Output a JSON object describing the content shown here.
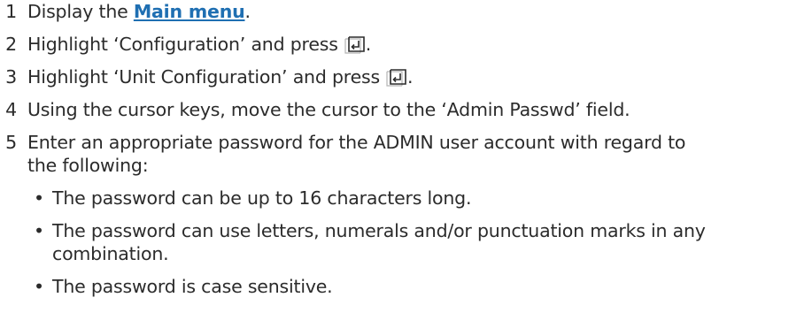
{
  "steps": [
    {
      "num": "1",
      "pre": "Display the ",
      "link": "Main menu",
      "post": "."
    },
    {
      "num": "2",
      "text": "Highlight ‘Configuration’ and press",
      "post": ".",
      "key": "enter-key"
    },
    {
      "num": "3",
      "text": "Highlight ‘Unit Configuration’ and press",
      "post": ".",
      "key": "enter-key"
    },
    {
      "num": "4",
      "text": "Using the cursor keys, move the cursor to the ‘Admin Passwd’ field."
    },
    {
      "num": "5",
      "line1": "Enter an appropriate password for the ADMIN user account with regard to",
      "line2": "the following:"
    }
  ],
  "bullets": [
    {
      "text": "The password can be up to 16 characters long."
    },
    {
      "line1": "The password can use letters, numerals and/or punctuation marks in any",
      "line2": "combination."
    },
    {
      "text": "The password is case sensitive."
    }
  ],
  "colors": {
    "link": "#1f6fb2",
    "text": "#2b2b2b"
  }
}
